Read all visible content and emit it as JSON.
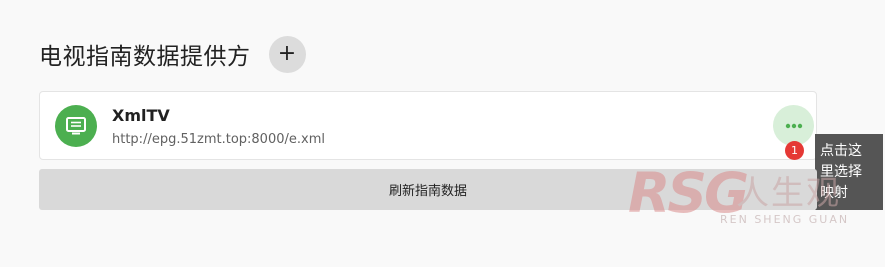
{
  "header": {
    "title": "电视指南数据提供方",
    "add_label": "+"
  },
  "provider": {
    "name": "XmlTV",
    "url": "http://epg.51zmt.top:8000/e.xml"
  },
  "badge": {
    "count": "1"
  },
  "tooltip": {
    "lines": [
      "点击这",
      "里选择",
      "映射"
    ]
  },
  "refresh": {
    "label": "刷新指南数据"
  },
  "watermark": {
    "logo": "RSG",
    "brand": "人生观",
    "sub": "REN SHENG GUAN"
  },
  "colors": {
    "accent": "#4caf50",
    "accent_soft": "#d8efd9",
    "badge": "#e53935",
    "tooltip": "#555555"
  },
  "icons": {
    "provider": "tv-guide-icon",
    "more": "more-dots-icon"
  }
}
